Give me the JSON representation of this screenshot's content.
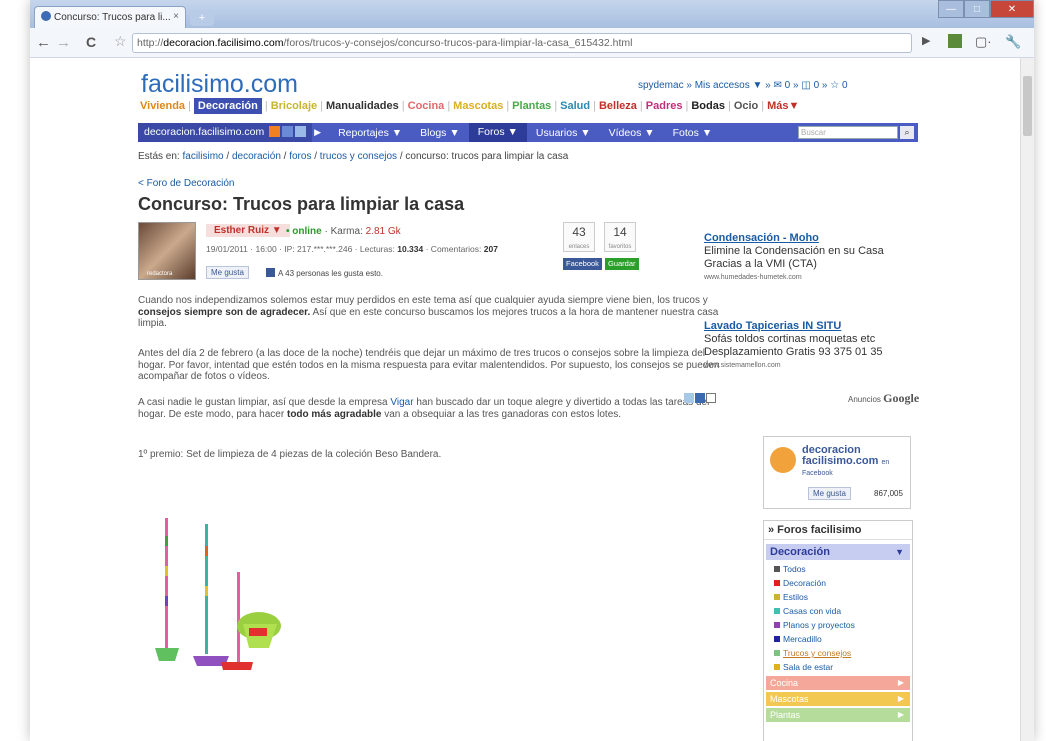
{
  "browser": {
    "tab_title": "Concurso: Trucos para li...",
    "tab_close": "×",
    "url_prefix": "http://",
    "url_domain": "decoracion.facilisimo.com",
    "url_path": "/foros/trucos-y-consejos/concurso-trucos-para-limpiar-la-casa_615432.html"
  },
  "site": {
    "logo": "facilisimo.com",
    "userbar": "spydemac » Mis accesos ▼ » ✉ 0 » ◫ 0 » ☆ 0",
    "categories": [
      "Vivienda",
      "Decoración",
      "Bricolaje",
      "Manualidades",
      "Cocina",
      "Mascotas",
      "Plantas",
      "Salud",
      "Belleza",
      "Padres",
      "Bodas",
      "Ocio",
      "Más▼"
    ],
    "category_colors": [
      "#e0861a",
      "#3d4fb0",
      "#c9b430",
      "#333333",
      "#e06a6a",
      "#d9b020",
      "#4aaa4a",
      "#2a8ab0",
      "#c0302a",
      "#c0307a",
      "#222222",
      "#555555",
      "#c0302a"
    ],
    "nav_site": "decoracion.facilisimo.com",
    "nav_items": [
      "Reportajes ▼",
      "Blogs ▼",
      "Foros ▼",
      "Usuarios ▼",
      "Vídeos ▼",
      "Fotos ▼"
    ],
    "search_placeholder": "Buscar",
    "breadcrumb_prefix": "Estás en:",
    "breadcrumb": [
      "facilisimo",
      "decoración",
      "foros",
      "trucos y consejos"
    ],
    "breadcrumb_current": "concurso: trucos para limpiar la casa"
  },
  "post": {
    "back_link": "< Foro de Decoración",
    "title": "Concurso: Trucos para limpiar la casa",
    "avatar_label": "redactora",
    "author": "Esther Ruiz ▼",
    "online": "• online",
    "karma_label": "· Karma:",
    "karma": "2.81 Gk",
    "meta": "19/01/2011 · 16:00 · IP: 217.***.***.246 · Lecturas:",
    "reads": "10.334",
    "comments_label": "· Comentarios:",
    "comments": "207",
    "like_btn": "Me gusta",
    "likes_text": "A 43 personas les gusta esto.",
    "stat1_num": "43",
    "stat1_label": "enlaces",
    "stat2_num": "14",
    "stat2_label": "favoritos",
    "btn_facebook": "Facebook",
    "btn_save": "Guardar",
    "p1a": "Cuando nos independizamos solemos estar muy perdidos en este tema así que cualquier ayuda siempre viene bien, los trucos y ",
    "p1b": "consejos siempre son de agradecer.",
    "p1c": " Así que en este concurso buscamos los mejores trucos a la hora de mantener nuestra casa limpia.",
    "p2": "Antes del día 2 de febrero (a las doce de la noche) tendréis que dejar un máximo de tres trucos o consejos sobre la limpieza del hogar. Por favor, intentad que estén todos en la misma respuesta para evitar malentendidos. Por supuesto, los consejos se pueden acompañar de fotos o vídeos.",
    "p3a": "A casi nadie le gustan limpiar, así que desde la empresa ",
    "p3link": "Vigar",
    "p3b": " han buscado dar un toque alegre y divertido a todas las tareas del hogar. De este modo, para hacer ",
    "p3bold": "todo más agradable",
    "p3c": " van a obsequiar a las tres ganadoras con estos lotes.",
    "p4": "1º premio: Set de limpieza de 4 piezas de la coleción Beso Bandera."
  },
  "ads": [
    {
      "title": "Condensación - Moho",
      "l1": "Elimine la Condensación en su Casa",
      "l2": "Gracias a la VMI (CTA)",
      "url": "www.humedades-humetek.com"
    },
    {
      "title": "Lavado Tapicerias IN SITU",
      "l1": "Sofás toldos cortinas moquetas etc",
      "l2": "Desplazamiento Gratis 93 375 01 35",
      "url": "www.sistemamellon.com"
    }
  ],
  "ads_label": "Anuncios",
  "ads_brand": "Google",
  "fb": {
    "name": "decoracion facilisimo.com",
    "en": "en",
    "sub": "Facebook",
    "like": "Me gusta",
    "count": "867,005"
  },
  "forums": {
    "header": "» Foros facilisimo",
    "active": "Decoración",
    "items": [
      "Todos",
      "Decoración",
      "Estilos",
      "Casas con vida",
      "Planos y proyectos",
      "Mercadillo",
      "Trucos y consejos",
      "Sala de estar"
    ],
    "item_colors": [
      "#555555",
      "#e02020",
      "#c9b430",
      "#40c0b0",
      "#9040b0",
      "#2020a0",
      "#80c080",
      "#e0b020"
    ],
    "sections": [
      {
        "name": "Cocina",
        "color": "#f5a89a"
      },
      {
        "name": "Mascotas",
        "color": "#f2c850"
      },
      {
        "name": "Plantas",
        "color": "#b5dc9a"
      }
    ]
  }
}
